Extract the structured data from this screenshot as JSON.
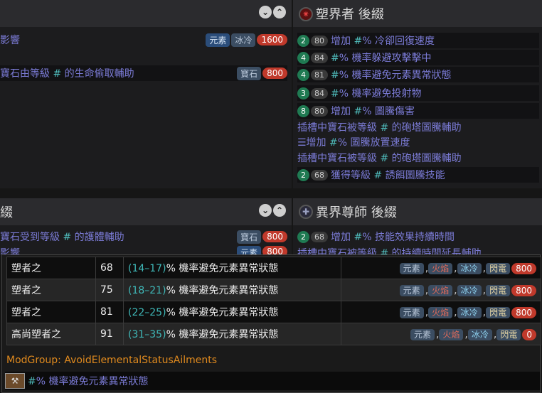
{
  "top_left": {
    "rows": [
      {
        "label": "影響",
        "tags": [
          "元素",
          "冰冷"
        ],
        "weight": "1600"
      },
      {
        "label": "寶石由等級 # 的生命偷取輔助",
        "tags": [
          "寶石"
        ],
        "weight": "800"
      }
    ]
  },
  "top_right": {
    "title": "塑界者 後綴",
    "rows": [
      {
        "tier": "2",
        "level": "80",
        "label": "增加 #% 冷卻回復速度"
      },
      {
        "tier": "4",
        "level": "84",
        "label": "#% 機率躲避攻擊擊中"
      },
      {
        "tier": "4",
        "level": "81",
        "label": "#% 機率避免元素異常狀態"
      },
      {
        "tier": "3",
        "level": "84",
        "label": "#% 機率避免投射物"
      },
      {
        "tier": "8",
        "level": "80",
        "label": "增加 #% 圖騰傷害"
      },
      {
        "label": "插槽中寶石被等級 # 的砲塔圖騰輔助"
      },
      {
        "label": "☰增加 #% 圖騰放置速度"
      },
      {
        "label": "插槽中寶石被等級 # 的砲塔圖騰輔助"
      },
      {
        "tier": "2",
        "level": "68",
        "label": "獲得等級 # 誘餌圖騰技能"
      }
    ]
  },
  "bottom_left": {
    "title": "綴",
    "rows": [
      {
        "label": "寶石受到等級 # 的護體輔助",
        "tags": [
          "寶石"
        ],
        "weight": "800"
      },
      {
        "label": "影響",
        "tags": [
          "元素"
        ],
        "weight": "800"
      }
    ]
  },
  "bottom_right": {
    "title": "異界尊師 後綴",
    "rows": [
      {
        "tier": "2",
        "level": "68",
        "label": "增加 #% 技能效果持續時間"
      },
      {
        "label": "插槽中寶石被等級 # 的持續時間延長輔助"
      }
    ]
  },
  "popup": {
    "rows": [
      {
        "name": "塑者之",
        "level": "68",
        "range": "(14–17)",
        "stat": "% 機率避免元素異常狀態",
        "tags": [
          "元素",
          "火焰",
          "冰冷",
          "閃電"
        ],
        "weight": "800"
      },
      {
        "name": "塑者之",
        "level": "75",
        "range": "(18–21)",
        "stat": "% 機率避免元素異常狀態",
        "tags": [
          "元素",
          "火焰",
          "冰冷",
          "閃電"
        ],
        "weight": "800"
      },
      {
        "name": "塑者之",
        "level": "81",
        "range": "(22–25)",
        "stat": "% 機率避免元素異常狀態",
        "tags": [
          "元素",
          "火焰",
          "冰冷",
          "閃電"
        ],
        "weight": "800"
      },
      {
        "name": "高尚塑者之",
        "level": "91",
        "range": "(31–35)",
        "stat": "% 機率避免元素異常狀態",
        "tags": [
          "元素",
          "火焰",
          "冰冷",
          "閃電"
        ],
        "weight": "0"
      }
    ],
    "modgroup": "ModGroup: AvoidElementalStatusAilments",
    "footer_label": "#% 機率避免元素異常狀態",
    "sep": ","
  }
}
